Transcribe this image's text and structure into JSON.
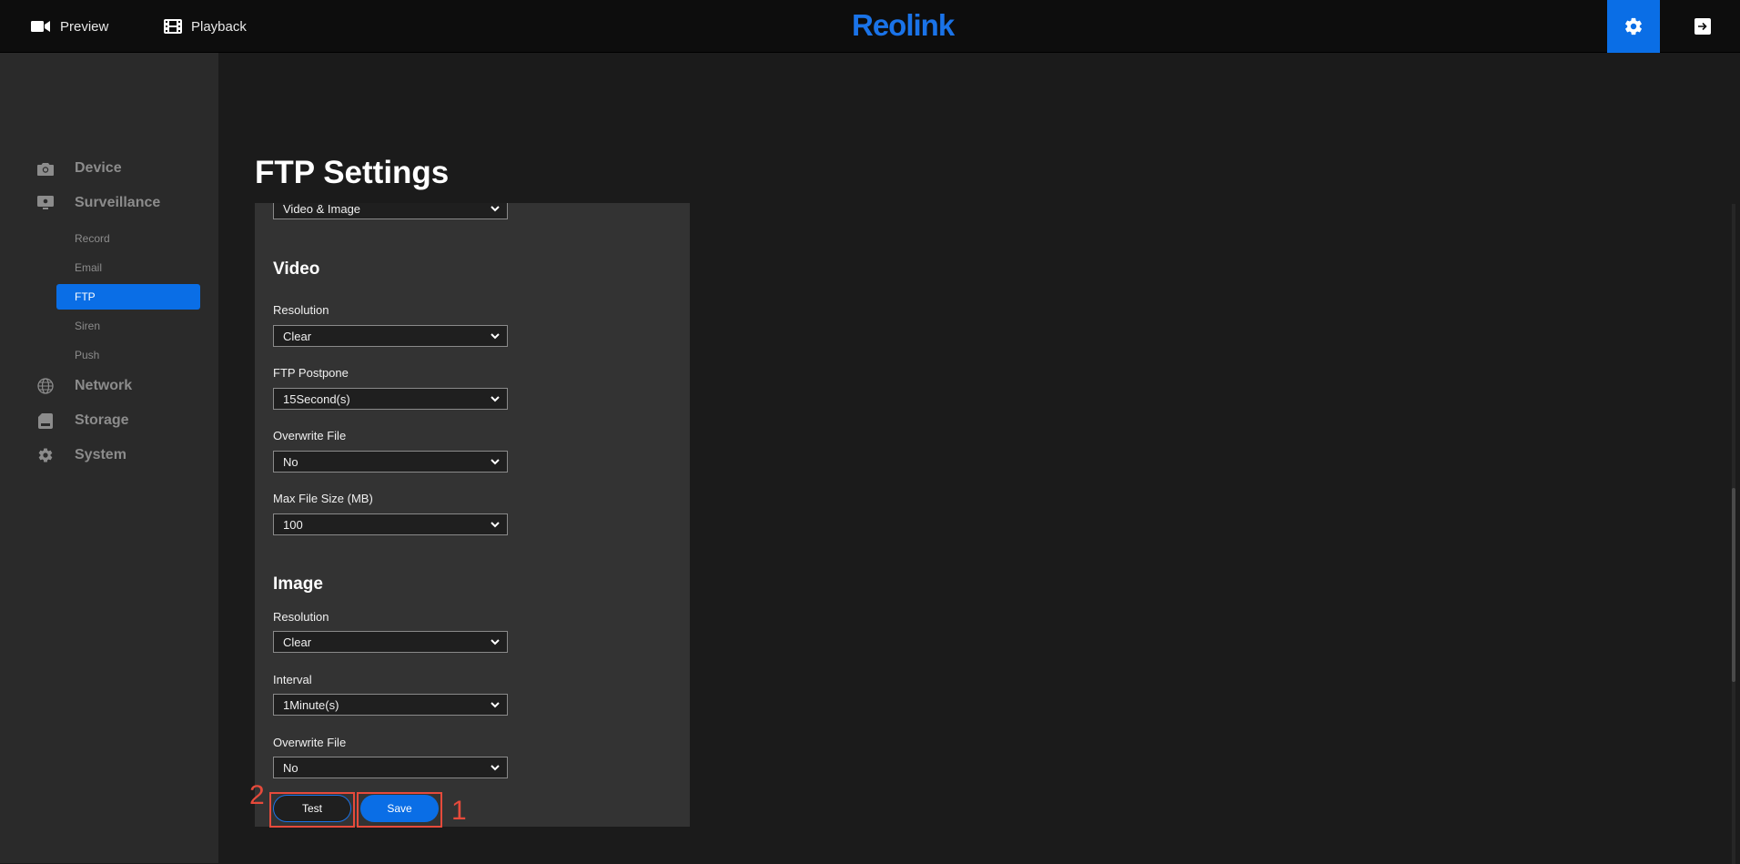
{
  "topbar": {
    "preview_label": "Preview",
    "playback_label": "Playback",
    "logo_text": "Reolink",
    "accent_color": "#0a6ee6"
  },
  "sidebar": {
    "groups": [
      {
        "label": "Device",
        "icon": "camera-icon"
      },
      {
        "label": "Surveillance",
        "icon": "monitor-icon"
      },
      {
        "label": "Network",
        "icon": "globe-icon"
      },
      {
        "label": "Storage",
        "icon": "storage-icon"
      },
      {
        "label": "System",
        "icon": "gear-icon"
      }
    ],
    "sub_items": [
      {
        "label": "Record"
      },
      {
        "label": "Email"
      },
      {
        "label": "FTP",
        "active": true
      },
      {
        "label": "Siren"
      },
      {
        "label": "Push"
      }
    ]
  },
  "main": {
    "title": "FTP Settings",
    "upload_type_value": "Video & Image",
    "video": {
      "title": "Video",
      "resolution_label": "Resolution",
      "resolution_value": "Clear",
      "postpone_label": "FTP Postpone",
      "postpone_value": "15Second(s)",
      "overwrite_label": "Overwrite File",
      "overwrite_value": "No",
      "max_size_label": "Max File Size (MB)",
      "max_size_value": "100"
    },
    "image": {
      "title": "Image",
      "resolution_label": "Resolution",
      "resolution_value": "Clear",
      "interval_label": "Interval",
      "interval_value": "1Minute(s)",
      "overwrite_label": "Overwrite File",
      "overwrite_value": "No"
    },
    "test_label": "Test",
    "save_label": "Save"
  },
  "annotations": {
    "save_marker": "1",
    "test_marker": "2",
    "color": "#e64a3b"
  }
}
